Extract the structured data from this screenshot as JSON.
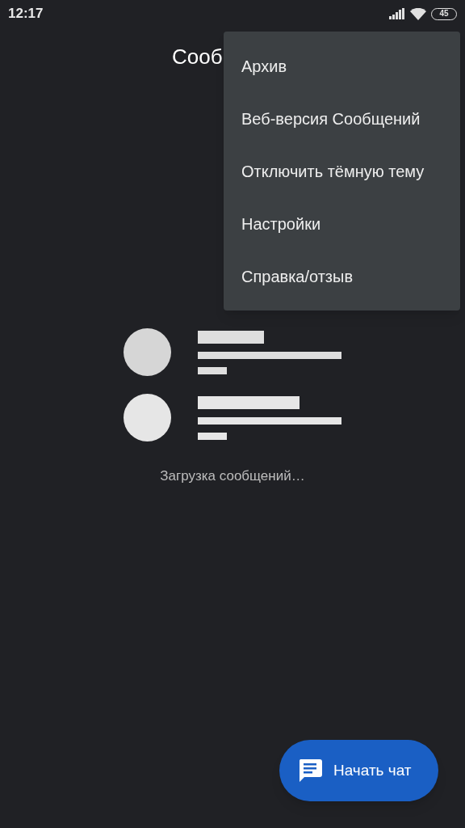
{
  "status_bar": {
    "time": "12:17",
    "battery": "45"
  },
  "app_bar": {
    "title": "Сооб"
  },
  "menu": {
    "items": [
      {
        "label": "Архив"
      },
      {
        "label": "Веб-версия Сообщений"
      },
      {
        "label": "Отключить тёмную тему"
      },
      {
        "label": "Настройки"
      },
      {
        "label": "Справка/отзыв"
      }
    ]
  },
  "loading": {
    "text": "Загрузка сообщений…"
  },
  "fab": {
    "label": "Начать чат"
  }
}
